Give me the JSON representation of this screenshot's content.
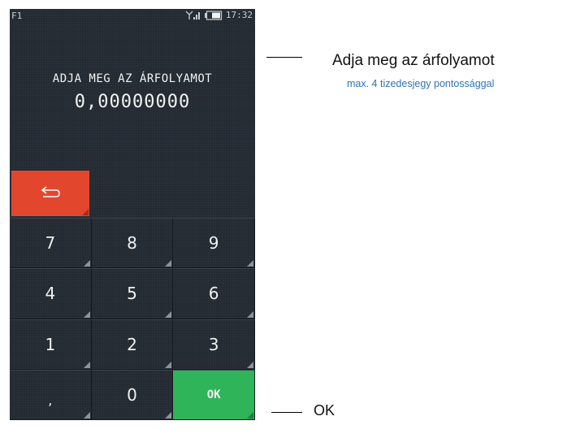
{
  "status_bar": {
    "fkey": "F1",
    "time": "17:32",
    "icons": [
      "signal-icon",
      "battery-icon"
    ]
  },
  "screen": {
    "prompt": "ADJA MEG AZ ÁRFOLYAMOT",
    "value": "0,00000000"
  },
  "keypad": {
    "back_icon": "return-arrow-icon",
    "keys": [
      "7",
      "8",
      "9",
      "4",
      "5",
      "6",
      "1",
      "2",
      "3",
      ",",
      "0",
      "OK"
    ]
  },
  "annotations": {
    "prompt_title": "Adja meg az árfolyamot",
    "prompt_note": "max. 4 tizedesjegy pontossággal",
    "ok_label": "OK"
  },
  "colors": {
    "screen_bg": "#232a33",
    "back_button": "#e2472e",
    "ok_button": "#2fb45a",
    "note_text": "#2e74b5"
  }
}
